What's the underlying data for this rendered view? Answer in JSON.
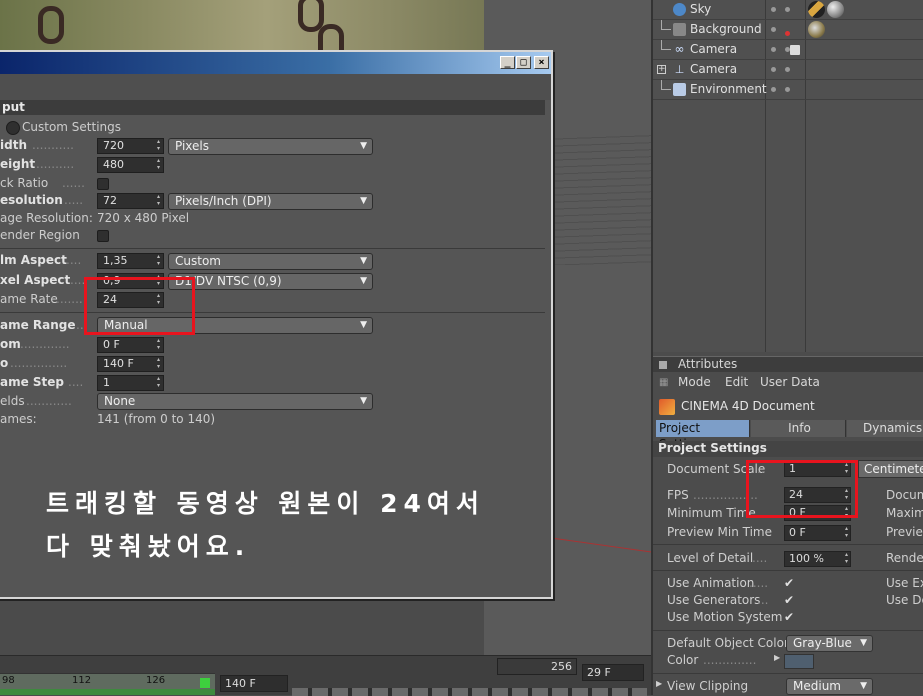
{
  "object_manager": {
    "objects": [
      {
        "name": "Sky",
        "icon": "sky-icon"
      },
      {
        "name": "Background",
        "icon": "background-icon"
      },
      {
        "name": "Camera",
        "icon": "camera-icon"
      },
      {
        "name": "Camera",
        "icon": "camera-icon"
      },
      {
        "name": "Environment",
        "icon": "environment-icon"
      }
    ]
  },
  "timeline": {
    "frame_left": "98",
    "frame_mid1": "112",
    "frame_mid2": "126",
    "end_frame": "140 F",
    "frame_256": "256",
    "current_frame": "29 F"
  },
  "render_settings": {
    "section_title": "put",
    "custom_settings_label": "Custom Settings",
    "rows": {
      "width_label": "idth",
      "width_value": "720",
      "width_unit": "Pixels",
      "height_label": "eight",
      "height_value": "480",
      "lock_ratio_label": "ck Ratio",
      "resolution_label": "esolution",
      "resolution_value": "72",
      "resolution_unit": "Pixels/Inch (DPI)",
      "image_resolution_label": "age Resolution:",
      "image_resolution_value": "720 x 480 Pixel",
      "render_region_label": "ender Region",
      "film_aspect_label": "lm Aspect",
      "film_aspect_value": "1,35",
      "film_aspect_preset": "Custom",
      "pixel_aspect_label": "xel Aspect",
      "pixel_aspect_value": "0,9",
      "pixel_aspect_preset": "D1/DV NTSC (0,9)",
      "frame_rate_label": "ame Rate",
      "frame_rate_value": "24",
      "frame_range_label": "ame Range",
      "frame_range_value": "Manual",
      "from_label": "om",
      "from_value": "0 F",
      "to_label": "o",
      "to_value": "140 F",
      "frame_step_label": "ame Step",
      "frame_step_value": "1",
      "fields_label": "elds",
      "fields_value": "None",
      "frames_label": "ames:",
      "frames_value": "141 (from 0 to 140)"
    }
  },
  "annotation": {
    "line1": "트래킹할 동영상 원본이 24여서",
    "line2": "다 맞춰놨어요."
  },
  "attributes": {
    "title": "Attributes",
    "menu": [
      "Mode",
      "Edit",
      "User Data"
    ],
    "document_title": "CINEMA 4D Document",
    "tabs": [
      "Project Settings",
      "Info",
      "Dynamics"
    ],
    "section_title": "Project Settings",
    "document_scale_label": "Document Scale",
    "document_scale_value": "1",
    "document_scale_unit": "Centimeter",
    "fps_label": "FPS",
    "fps_value": "24",
    "min_time_label": "Minimum Time",
    "min_time_value": "0 F",
    "preview_min_label": "Preview Min Time",
    "preview_min_value": "0 F",
    "right_labels": [
      "Docum",
      "Maxim",
      "Previe",
      "Rende",
      "Use Ex",
      "Use De"
    ],
    "level_of_detail_label": "Level of Detail",
    "level_of_detail_value": "100 %",
    "use_animation_label": "Use Animation",
    "use_generators_label": "Use Generators",
    "use_motion_label": "Use Motion System",
    "check_mark": "✔",
    "default_color_label": "Default Object Color",
    "default_color_value": "Gray-Blue",
    "color_label": "Color",
    "view_clipping_label": "View Clipping",
    "view_clipping_value": "Medium"
  },
  "colors": {
    "highlight": "#e8141e",
    "active_tab": "#7d9ec8"
  }
}
